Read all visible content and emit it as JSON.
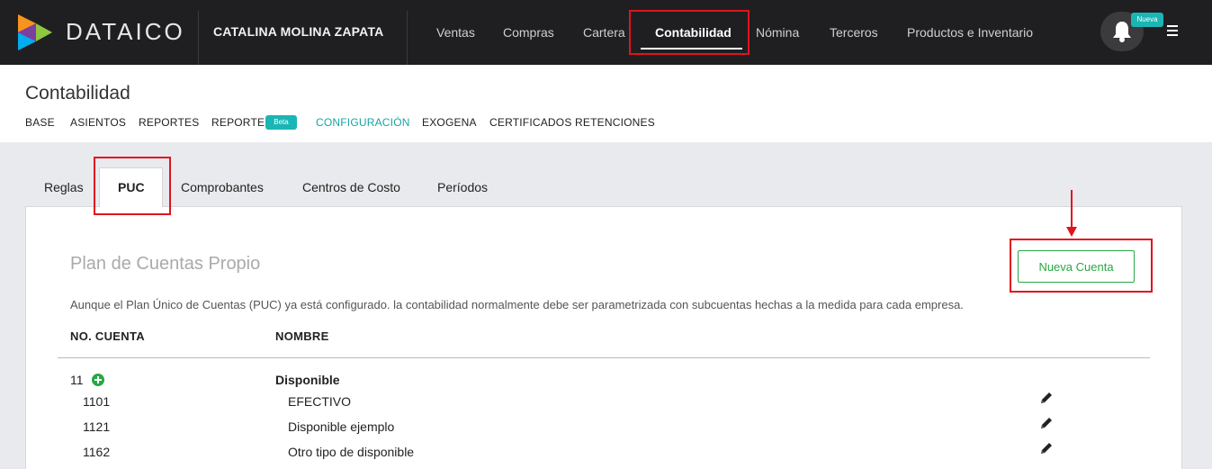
{
  "topbar": {
    "brand": "DATAICO",
    "company": "CATALINA MOLINA ZAPATA",
    "nav": [
      "Ventas",
      "Compras",
      "Cartera",
      "Contabilidad",
      "Nómina",
      "Terceros",
      "Productos e Inventario"
    ],
    "active_nav": "Contabilidad",
    "bell_badge": "Nueva",
    "icons": [
      "dataico-logo",
      "bell-icon",
      "menu-icon"
    ]
  },
  "header": {
    "title": "Contabilidad",
    "subnav": [
      "BASE",
      "ASIENTOS",
      "REPORTES",
      "REPORTES",
      "CONFIGURACIÓN",
      "EXOGENA",
      "CERTIFICADOS RETENCIONES"
    ],
    "beta_badge": "Beta",
    "active_subnav": "CONFIGURACIÓN"
  },
  "tabs": [
    "Reglas",
    "PUC",
    "Comprobantes",
    "Centros de Costo",
    "Períodos"
  ],
  "active_tab": "PUC",
  "panel": {
    "title": "Plan de Cuentas Propio",
    "new_button": "Nueva Cuenta",
    "description": "Aunque el Plan Único de Cuentas (PUC) ya está configurado. la contabilidad normalmente debe ser parametrizada con subcuentas hechas a la medida para cada empresa.",
    "columns": [
      "NO. CUENTA",
      "NOMBRE"
    ],
    "group": {
      "code": "11",
      "name": "Disponible"
    },
    "rows": [
      {
        "code": "1101",
        "name": "EFECTIVO"
      },
      {
        "code": "1121",
        "name": "Disponible ejemplo"
      },
      {
        "code": "1162",
        "name": "Otro tipo de disponible"
      }
    ]
  },
  "colors": {
    "topbar": "#1f1f21",
    "accent": "#1ab5b5",
    "success": "#28a745",
    "annotation": "#e0141e"
  }
}
